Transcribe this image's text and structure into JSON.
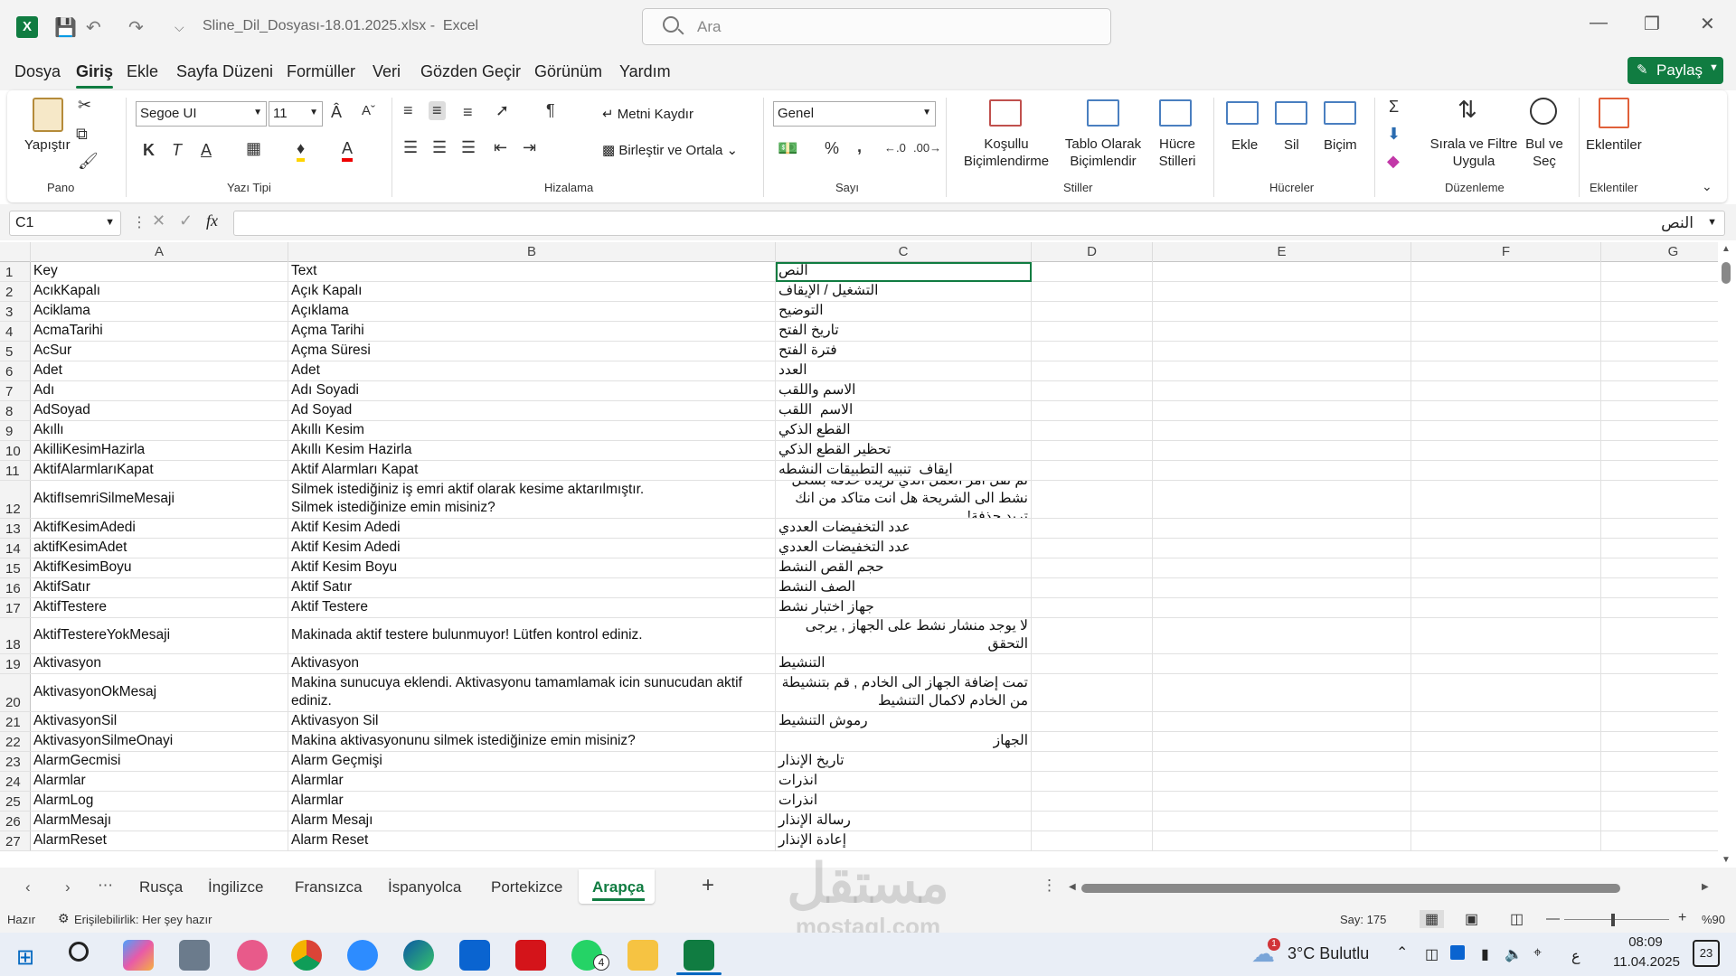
{
  "window": {
    "filename": "Sline_Dil_Dosyası-18.01.2025.xlsx",
    "app": "Excel",
    "search_placeholder": "Ara"
  },
  "menu": [
    "Dosya",
    "Giriş",
    "Ekle",
    "Sayfa Düzeni",
    "Formüller",
    "Veri",
    "Gözden Geçir",
    "Görünüm",
    "Yardım"
  ],
  "share_label": "Paylaş",
  "ribbon": {
    "paste": "Yapıştır",
    "grp_clipboard": "Pano",
    "font_name": "Segoe UI",
    "font_size": "11",
    "grp_font": "Yazı Tipi",
    "bold": "K",
    "italic": "T",
    "underline": "A",
    "wrap": "Metni Kaydır",
    "merge": "Birleştir ve Ortala",
    "grp_align": "Hizalama",
    "number_format": "Genel",
    "grp_number": "Sayı",
    "percent": "%",
    "cond_fmt1": "Koşullu",
    "cond_fmt2": "Biçimlendirme",
    "table_fmt1": "Tablo Olarak",
    "table_fmt2": "Biçimlendir",
    "cell_styles1": "Hücre",
    "cell_styles2": "Stilleri",
    "grp_styles": "Stiller",
    "insert": "Ekle",
    "delete": "Sil",
    "format": "Biçim",
    "grp_cells": "Hücreler",
    "sort1": "Sırala ve Filtre",
    "sort2": "Uygula",
    "find1": "Bul ve",
    "find2": "Seç",
    "grp_edit": "Düzenleme",
    "addins": "Eklentiler",
    "grp_addins": "Eklentiler"
  },
  "formula_bar": {
    "name_box": "C1",
    "content": "النص",
    "fx": "fx"
  },
  "columns": [
    "A",
    "B",
    "C",
    "D",
    "E",
    "F",
    "G"
  ],
  "rows": [
    {
      "n": "1",
      "a": "Key",
      "b": "Text",
      "c": "النص"
    },
    {
      "n": "2",
      "a": "AcıkKapalı",
      "b": "Açık Kapalı",
      "c": "التشغيل / الإيقاف"
    },
    {
      "n": "3",
      "a": "Aciklama",
      "b": "Açıklama",
      "c": "التوضيح"
    },
    {
      "n": "4",
      "a": "AcmaTarihi",
      "b": "Açma Tarihi",
      "c": "تاريخ الفتح"
    },
    {
      "n": "5",
      "a": "AcSur",
      "b": "Açma Süresi",
      "c": "فترة الفتح"
    },
    {
      "n": "6",
      "a": "Adet",
      "b": "Adet",
      "c": "العدد"
    },
    {
      "n": "7",
      "a": "Adı",
      "b": "Adı Soyadi",
      "c": "الاسم واللقب"
    },
    {
      "n": "8",
      "a": "AdSoyad",
      "b": "Ad Soyad",
      "c": "الاسم  اللقب"
    },
    {
      "n": "9",
      "a": "Akıllı",
      "b": "Akıllı Kesim",
      "c": "القطع الذكي"
    },
    {
      "n": "10",
      "a": "AkilliKesimHazirla",
      "b": "Akıllı Kesim Hazirla",
      "c": "تحظير القطع الذكي"
    },
    {
      "n": "11",
      "a": "AktifAlarmlarıKapat",
      "b": "Aktif Alarmları Kapat",
      "c": "ايقاف  تنبيه التطبيقات النشطه"
    },
    {
      "n": "12",
      "a": "AktifIsemriSilmeMesaji",
      "b": "Silmek istediğiniz iş emri aktif olarak kesime aktarılmıştır.\nSilmek istediğinize emin misiniz?",
      "c": "تم نقل امر العمل الذي تريده حذفه بشكل نشط الى الشريحة هل انت متاكد من انك تريد حذفة!"
    },
    {
      "n": "13",
      "a": "AktifKesimAdedi",
      "b": "Aktif Kesim Adedi",
      "c": "عدد التخفيضات العددي"
    },
    {
      "n": "14",
      "a": "aktifKesimAdet",
      "b": "Aktif Kesim Adedi",
      "c": "عدد التخفيضات العددي"
    },
    {
      "n": "15",
      "a": "AktifKesimBoyu",
      "b": "Aktif Kesim Boyu",
      "c": "حجم القص النشط"
    },
    {
      "n": "16",
      "a": "AktifSatır",
      "b": "Aktif Satır",
      "c": "الصف النشط"
    },
    {
      "n": "17",
      "a": "AktifTestere",
      "b": "Aktif Testere",
      "c": "جهاز اختبار نشط"
    },
    {
      "n": "18",
      "a": "AktifTestereYokMesaji",
      "b": "Makinada aktif testere bulunmuyor! Lütfen kontrol ediniz.",
      "c": "لا يوجد منشار نشط على الجهاز , يرجى التحقق"
    },
    {
      "n": "19",
      "a": "Aktivasyon",
      "b": "Aktivasyon",
      "c": "التنشيط"
    },
    {
      "n": "20",
      "a": "AktivasyonOkMesaj",
      "b": "Makina sunucuya eklendi. Aktivasyonu tamamlamak icin sunucudan aktif ediniz.",
      "c": "تمت إضافة الجهاز الى الخادم , قم بتنشيطة من الخادم لاكمال التنشيط"
    },
    {
      "n": "21",
      "a": "AktivasyonSil",
      "b": "Aktivasyon Sil",
      "c": "رموش التنشيط"
    },
    {
      "n": "22",
      "a": "AktivasyonSilmeOnayi",
      "b": "Makina aktivasyonunu silmek istediğinize emin misiniz?",
      "c": "هل انت متاكد من انك تريد حذف تنشيط الجهاز"
    },
    {
      "n": "23",
      "a": "AlarmGecmisi",
      "b": "Alarm Geçmişi",
      "c": "تاريخ الإنذار"
    },
    {
      "n": "24",
      "a": "Alarmlar",
      "b": "Alarmlar",
      "c": "انذرات"
    },
    {
      "n": "25",
      "a": "AlarmLog",
      "b": "Alarmlar",
      "c": "انذرات"
    },
    {
      "n": "26",
      "a": "AlarmMesajı",
      "b": "Alarm Mesajı",
      "c": "رسالة الإنذار"
    },
    {
      "n": "27",
      "a": "AlarmReset",
      "b": "Alarm Reset",
      "c": "إعادة الإنذار"
    }
  ],
  "sheets": [
    "Rusça",
    "İngilizce",
    "Fransızca",
    "İspanyolca",
    "Portekizce",
    "Arapça"
  ],
  "status": {
    "ready": "Hazır",
    "accessibility": "Erişilebilirlik: Her şey hazır",
    "count": "Say: 175",
    "zoom": "%90"
  },
  "taskbar": {
    "weather": "3°C  Bulutlu",
    "time": "08:09",
    "date": "11.04.2025",
    "notif": "23",
    "lang": "ع",
    "whatsapp_badge": "4",
    "weather_badge": "1"
  },
  "watermark": {
    "text": "مستقل",
    "sub": "mostaql.com"
  }
}
